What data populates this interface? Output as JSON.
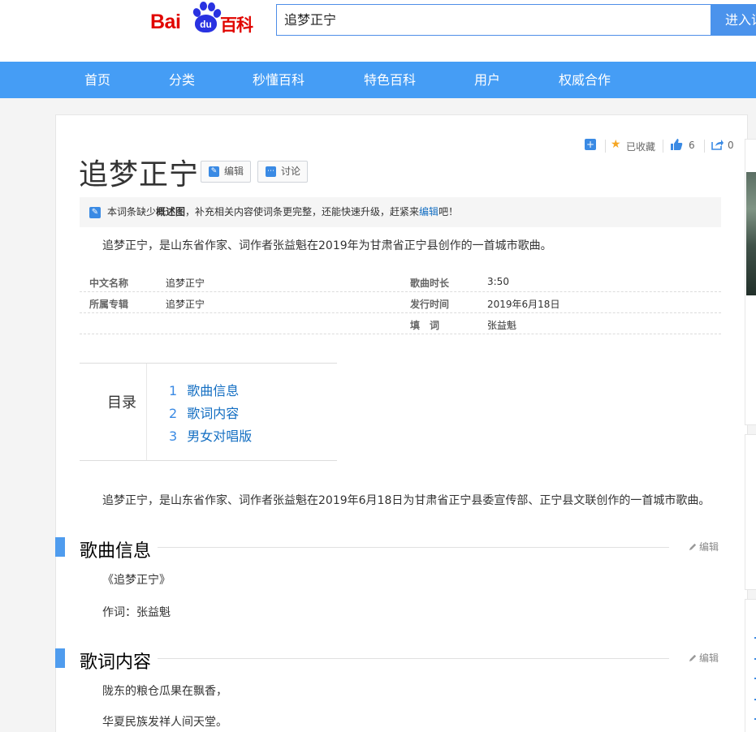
{
  "header": {
    "logo": {
      "part1": "Bai",
      "paw_text": "du",
      "part2": "百科"
    },
    "search_value": "追梦正宁",
    "search_button": "进入词条"
  },
  "nav": [
    "首页",
    "分类",
    "秒懂百科",
    "特色百科",
    "用户",
    "权威合作"
  ],
  "article": {
    "title": "追梦正宁",
    "edit_button": "编辑",
    "discuss_button": "讨论",
    "tools": {
      "collect": "已收藏",
      "like_count": "6",
      "share_count": "0"
    },
    "notice": {
      "pre": "本词条缺少",
      "bold": "概述图",
      "mid": "，补充相关内容使词条更完整，还能快速升级，赶紧来",
      "link": "编辑",
      "post": "吧！"
    },
    "summary": "追梦正宁，是山东省作家、词作者张益魁在2019年为甘肃省正宁县创作的一首城市歌曲。",
    "basic_info": [
      {
        "name": "中文名称",
        "value": "追梦正宁",
        "name2": "歌曲时长",
        "value2": "3:50"
      },
      {
        "name": "所属专辑",
        "value": "追梦正宁",
        "name2": "发行时间",
        "value2": "2019年6月18日"
      },
      {
        "name": "",
        "value": "",
        "name2": "填　词",
        "value2": "张益魁"
      }
    ],
    "catalog": {
      "label": "目录",
      "items": [
        {
          "num": "1",
          "text": "歌曲信息"
        },
        {
          "num": "2",
          "text": "歌词内容"
        },
        {
          "num": "3",
          "text": "男女对唱版"
        }
      ]
    },
    "intro": "追梦正宁，是山东省作家、词作者张益魁在2019年6月18日为甘肃省正宁县委宣传部、正宁县文联创作的一首城市歌曲。",
    "sections": [
      {
        "title": "歌曲信息",
        "edit": "编辑",
        "lines": [
          "《追梦正宁》",
          "作词：张益魁"
        ]
      },
      {
        "title": "歌词内容",
        "edit": "编辑",
        "lines": [
          "陇东的粮仓瓜果在飘香，",
          "华夏民族发祥人间天堂。"
        ]
      }
    ]
  }
}
